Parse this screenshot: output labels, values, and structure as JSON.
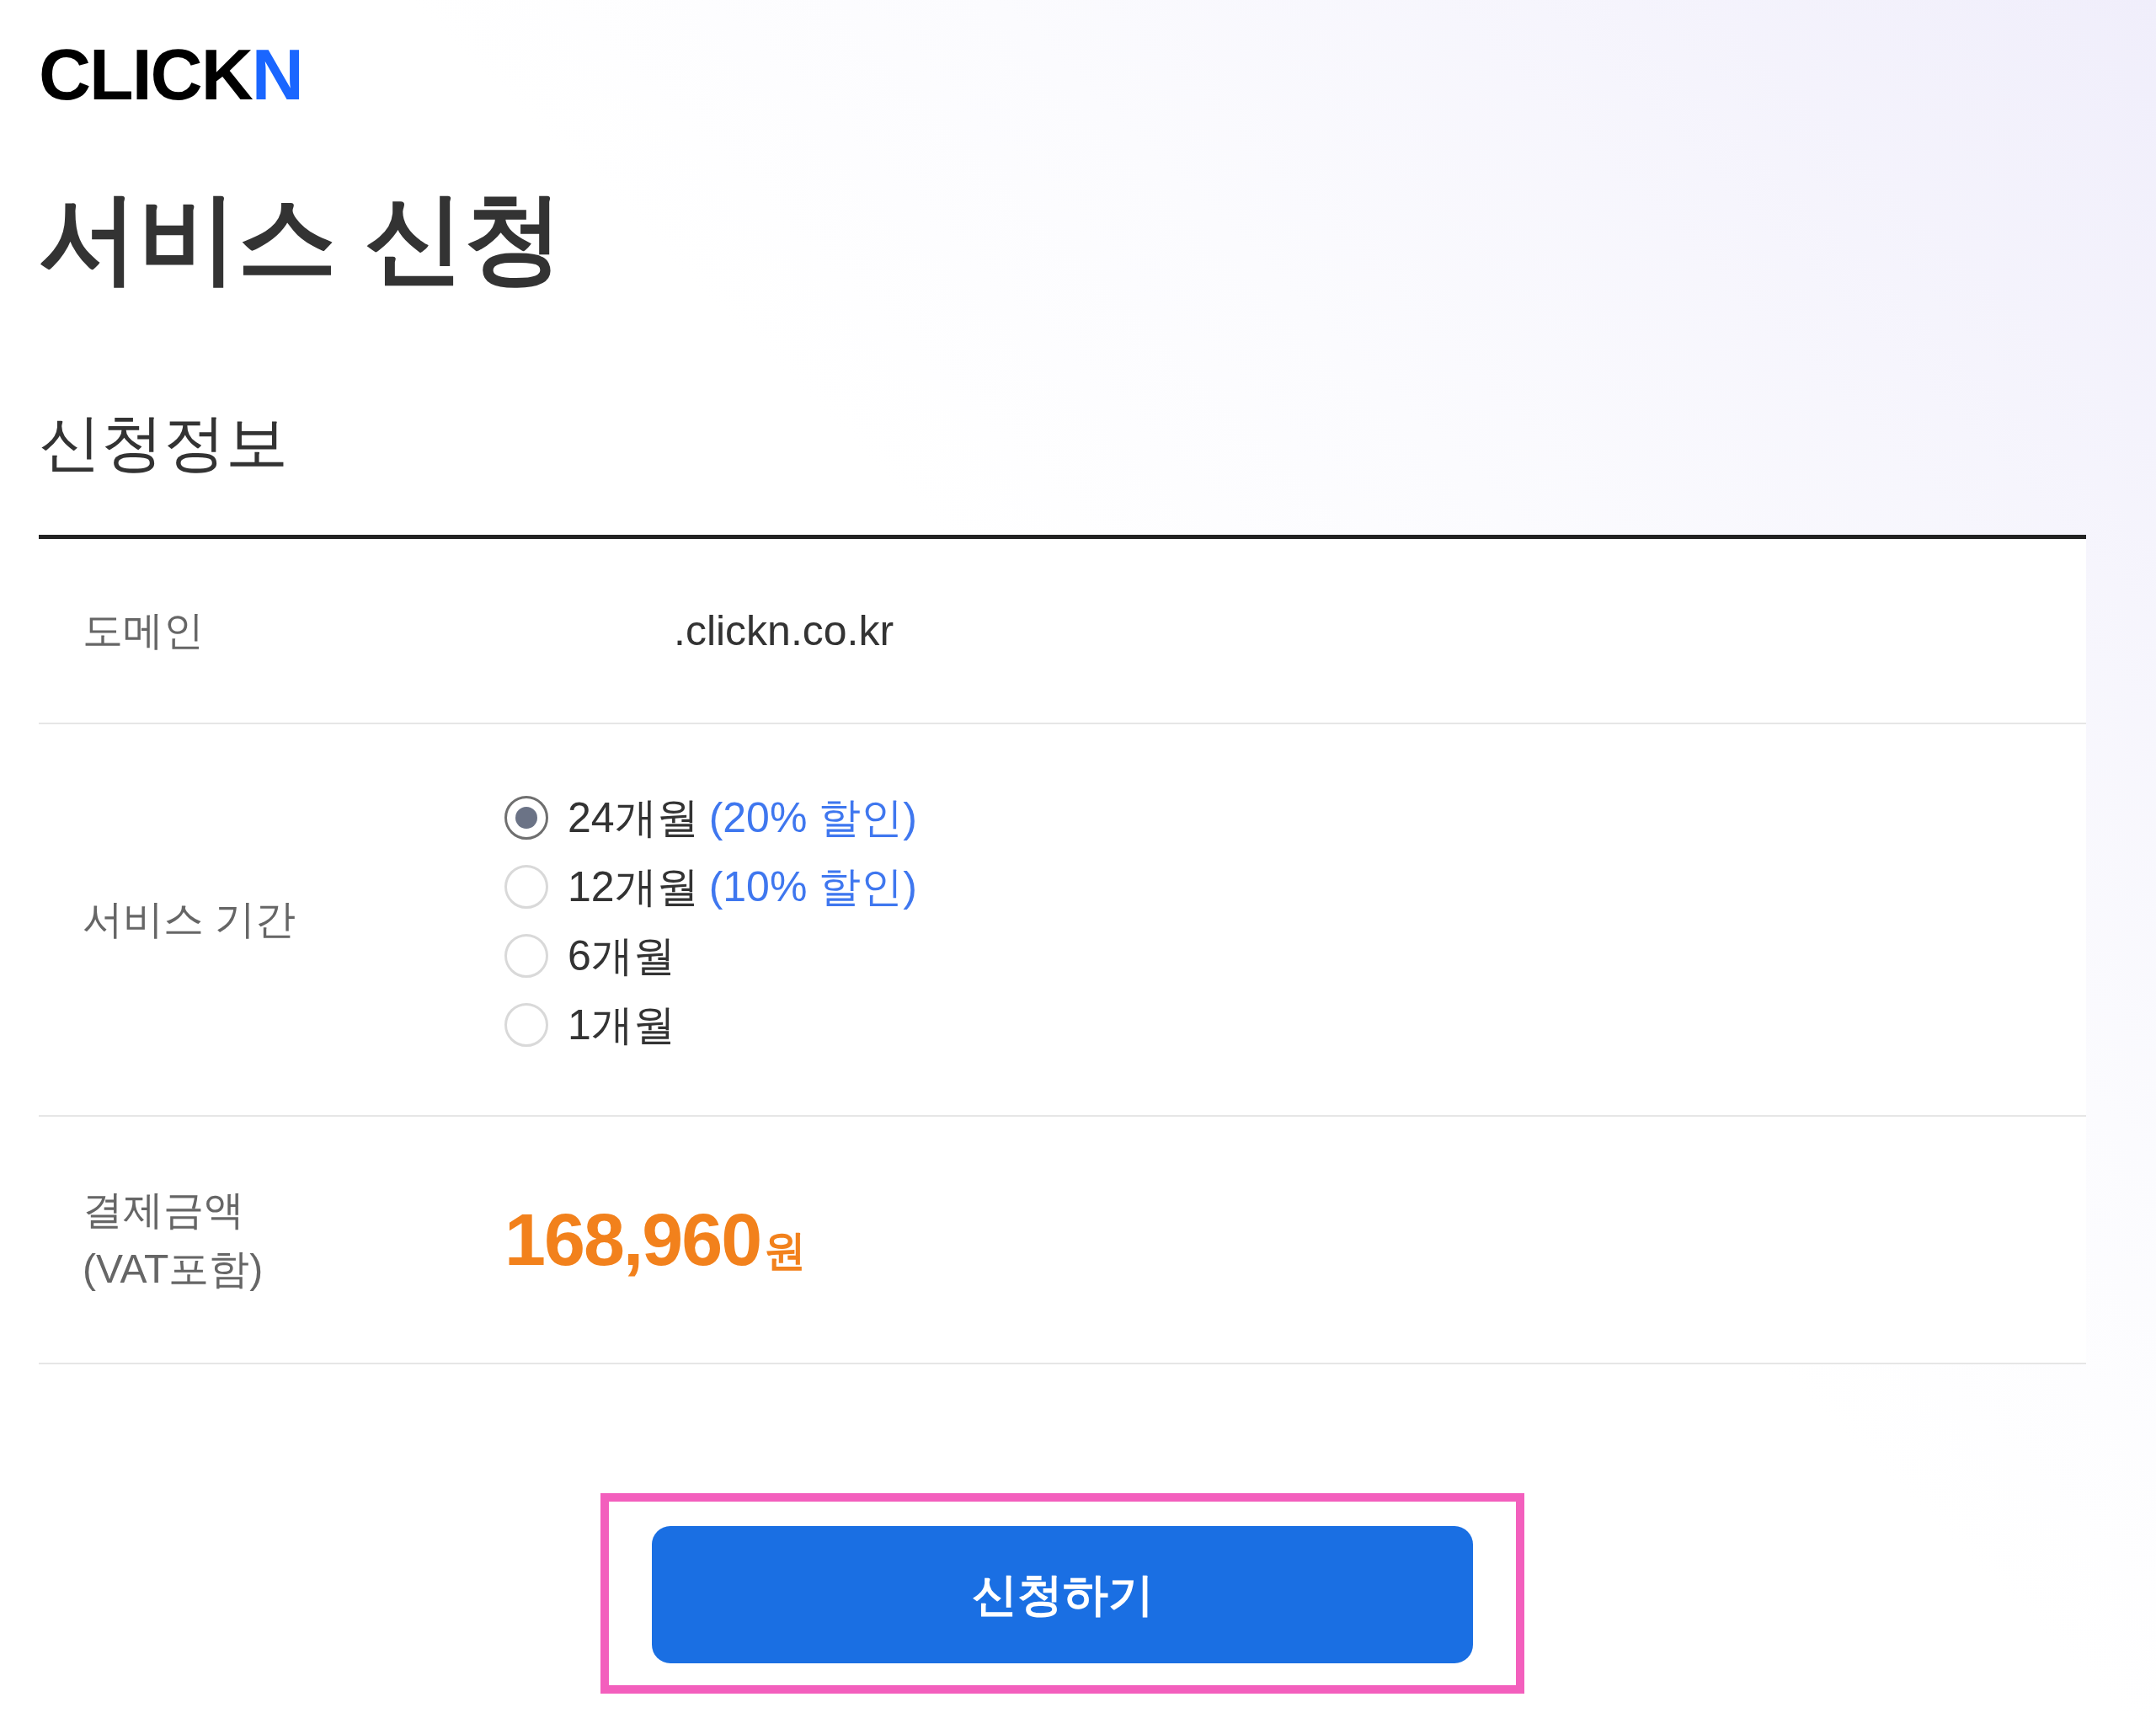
{
  "logo": {
    "text": "CLICK",
    "accent": "N"
  },
  "title": "서비스 신청",
  "section_title": "신청정보",
  "rows": [
    {
      "kind": "text",
      "label": "도메인",
      "value": ".clickn.co.kr"
    },
    {
      "kind": "radio",
      "label": "서비스 기간",
      "options": [
        {
          "label": "24개월",
          "note": "(20% 할인)",
          "selected": true
        },
        {
          "label": "12개월",
          "note": "(10% 할인)",
          "selected": false
        },
        {
          "label": "6개월",
          "selected": false
        },
        {
          "label": "1개월",
          "selected": false
        }
      ]
    },
    {
      "kind": "price",
      "label": "결제금액",
      "note": "(VAT포함)",
      "amount": "168,960",
      "unit": "원"
    }
  ],
  "submit_button": {
    "label": "신청하기",
    "highlighted": true
  }
}
